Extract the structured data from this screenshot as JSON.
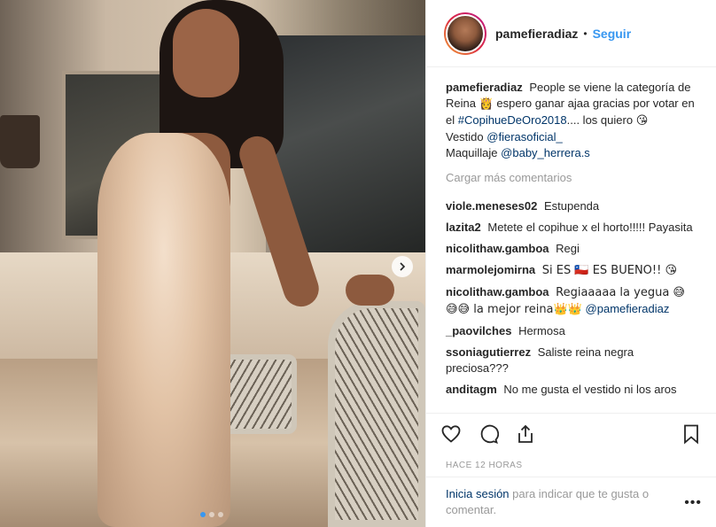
{
  "header": {
    "username": "pamefieradiaz",
    "separator": "•",
    "follow_label": "Seguir"
  },
  "caption": {
    "username": "pamefieradiaz",
    "text_1": "People se viene la categoría de Reina",
    "emoji_1": "👸",
    "text_2": " espero ganar ajaa gracias por votar en el",
    "hashtag": "#CopihueDeOro2018",
    "text_3": ".... los quiero",
    "emoji_2": "😘",
    "vestido_label": "Vestido",
    "vestido_mention": "@fierasoficial_",
    "maquillaje_label": "Maquillaje",
    "maquillaje_mention": "@baby_herrera.s"
  },
  "load_more_label": "Cargar más comentarios",
  "comments": [
    {
      "username": "viole.meneses02",
      "text": "Estupenda"
    },
    {
      "username": "lazita2",
      "text": "Metete el copihue x el horto!!!!! Payasita"
    },
    {
      "username": "nicolithaw.gamboa",
      "text": "Regi"
    },
    {
      "username": "marmolejomirna",
      "text": "Si ES 🇨🇱 ES BUENO!! 😘"
    },
    {
      "username": "nicolithaw.gamboa",
      "text": "Regiaaaaa la yegua 😅 😅😅 la mejor reina👑👑",
      "mention": "@pamefieradiaz"
    },
    {
      "username": "_paovilches",
      "text": "Hermosa"
    },
    {
      "username": "ssoniagutierrez",
      "text": "Saliste reina negra preciosa???"
    },
    {
      "username": "anditagm",
      "text": "No me gusta el vestido ni los aros"
    }
  ],
  "actions": {
    "like": "heart-icon",
    "comment": "comment-icon",
    "share": "share-icon",
    "save": "bookmark-icon"
  },
  "timestamp": "HACE 12 HORAS",
  "login": {
    "link": "Inicia sesión",
    "text": " para indicar que te gusta o comentar."
  },
  "more_label": "•••",
  "carousel": {
    "slides": 3,
    "current": 1
  }
}
